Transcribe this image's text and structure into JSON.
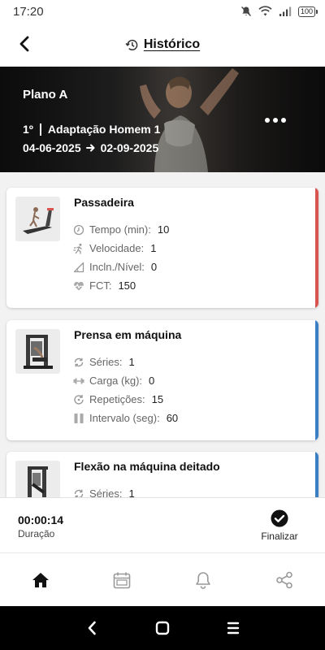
{
  "status_bar": {
    "time": "17:20",
    "battery": "100"
  },
  "header": {
    "title": "Histórico"
  },
  "hero": {
    "plan_name": "Plano A",
    "phase_number": "1º",
    "phase_name": "Adaptação Homem 1",
    "start_date": "04-06-2025",
    "end_date": "02-09-2025"
  },
  "exercises": [
    {
      "name": "Passadeira",
      "accent": "#d9534f",
      "metrics": [
        {
          "icon": "clock-icon",
          "label": "Tempo (min):",
          "value": "10"
        },
        {
          "icon": "running-icon",
          "label": "Velocidade:",
          "value": "1"
        },
        {
          "icon": "incline-icon",
          "label": "Incln./Nível:",
          "value": "0"
        },
        {
          "icon": "heartbeat-icon",
          "label": "FCT:",
          "value": "150"
        }
      ]
    },
    {
      "name": "Prensa em máquina",
      "accent": "#3a7fc4",
      "metrics": [
        {
          "icon": "repeat-icon",
          "label": "Séries:",
          "value": "1"
        },
        {
          "icon": "dumbbell-icon",
          "label": "Carga (kg):",
          "value": "0"
        },
        {
          "icon": "reps-icon",
          "label": "Repetições:",
          "value": "15"
        },
        {
          "icon": "pause-icon",
          "label": "Intervalo (seg):",
          "value": "60"
        }
      ]
    },
    {
      "name": "Flexão na máquina deitado",
      "accent": "#3a7fc4",
      "metrics": [
        {
          "icon": "repeat-icon",
          "label": "Séries:",
          "value": "1"
        }
      ]
    }
  ],
  "workout": {
    "timer": "00:00:14",
    "timer_label": "Duração",
    "finish_label": "Finalizar"
  },
  "bottom_nav": [
    "home-icon",
    "calendar-icon",
    "bell-icon",
    "share-icon"
  ]
}
